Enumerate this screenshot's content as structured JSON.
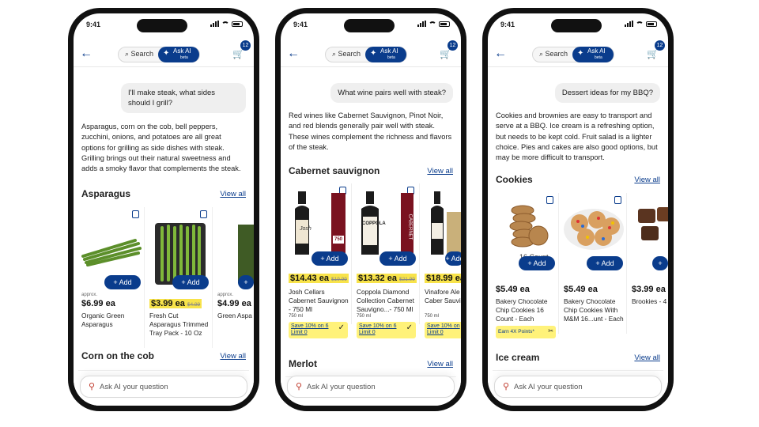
{
  "status_time": "9:41",
  "search_label": "Search",
  "ask_label": "Ask AI",
  "beta_label": "beta",
  "cart_count": "12",
  "ask_placeholder": "Ask AI your question",
  "phones": [
    {
      "question": "I'll make steak, what sides should I grill?",
      "answer": "Asparagus, corn on the cob, bell peppers, zucchini, onions, and potatoes are all great options for grilling as side dishes with steak.",
      "answer2": "Grilling brings out their natural sweetness and adds a smoky flavor that complements the steak.",
      "section1": "Asparagus",
      "section2": "Corn on the cob",
      "view_all": "View all",
      "products": [
        {
          "approx": "approx.",
          "price": "$6.99 ea",
          "was": "",
          "name": "Organic Green Asparagus",
          "size": "",
          "add": "Add",
          "highlight": false
        },
        {
          "approx": "",
          "price": "$3.99 ea",
          "was": "$4.99",
          "name": "Fresh Cut Asparagus Trimmed Tray Pack - 10 Oz",
          "size": "",
          "add": "Add",
          "highlight": true
        },
        {
          "approx": "approx.",
          "price": "$4.99 ea",
          "was": "",
          "name": "Green Aspa",
          "size": "",
          "add": "Add",
          "highlight": false
        }
      ]
    },
    {
      "question": "What wine pairs well with steak?",
      "answer": "Red wines like Cabernet Sauvignon, Pinot Noir, and red blends generally pair well with steak. These wines complement the richness and flavors of the steak.",
      "section1": "Cabernet sauvignon",
      "section2": "Merlot",
      "view_all": "View all",
      "products": [
        {
          "price": "$14.43 ea",
          "was": "$19.99",
          "name": "Josh Cellars Cabernet Sauvignon - 750 Ml",
          "size": "750 ml",
          "save": "Save 10% on 6",
          "limit": "Limit 0",
          "add": "Add",
          "label_text": "Josh",
          "label_side": "Cabernet Sauvignon",
          "label_num": "750",
          "highlight": true
        },
        {
          "price": "$13.32 ea",
          "was": "$21.99",
          "name": "Coppola Diamond Collection Cabernet Sauvigno...- 750 Ml",
          "size": "750 ml",
          "save": "Save 10% on 6",
          "limit": "Limit 0",
          "add": "Add",
          "label_text": "COPPOLA",
          "label_side": "CABERNET",
          "label_num": "",
          "highlight": true
        },
        {
          "price": "$18.99 ea",
          "was": "",
          "name": "Vinafore Ale Valley Caber Sauvigno...",
          "size": "750 ml",
          "save": "Save 10% on",
          "limit": "Limit 0",
          "add": "Add",
          "label_text": "",
          "label_side": "",
          "label_num": "",
          "highlight": true
        }
      ]
    },
    {
      "question": "Dessert ideas for my BBQ?",
      "answer": "Cookies and brownies are easy to transport and serve at a BBQ. Ice cream is a refreshing option, but needs to be kept cold. Fruit salad is a lighter choice. Pies and cakes are also good options, but may be more difficult to transport.",
      "section1": "Cookies",
      "section2": "Ice cream",
      "view_all": "View all",
      "products": [
        {
          "price": "$5.49 ea",
          "name": "Bakery Chocolate Chip Cookies 16 Count - Each",
          "overlay": "16 Count",
          "points": "Earn 4X Points*",
          "add": "Add"
        },
        {
          "price": "$5.49 ea",
          "name": "Bakery Chocolate Chip Cookies With M&M 16...unt - Each",
          "overlay": "",
          "points": "",
          "add": "Add"
        },
        {
          "price": "$3.99 ea",
          "name": "Brookies - 4",
          "overlay": "",
          "points": "",
          "add": "Add"
        }
      ]
    }
  ]
}
